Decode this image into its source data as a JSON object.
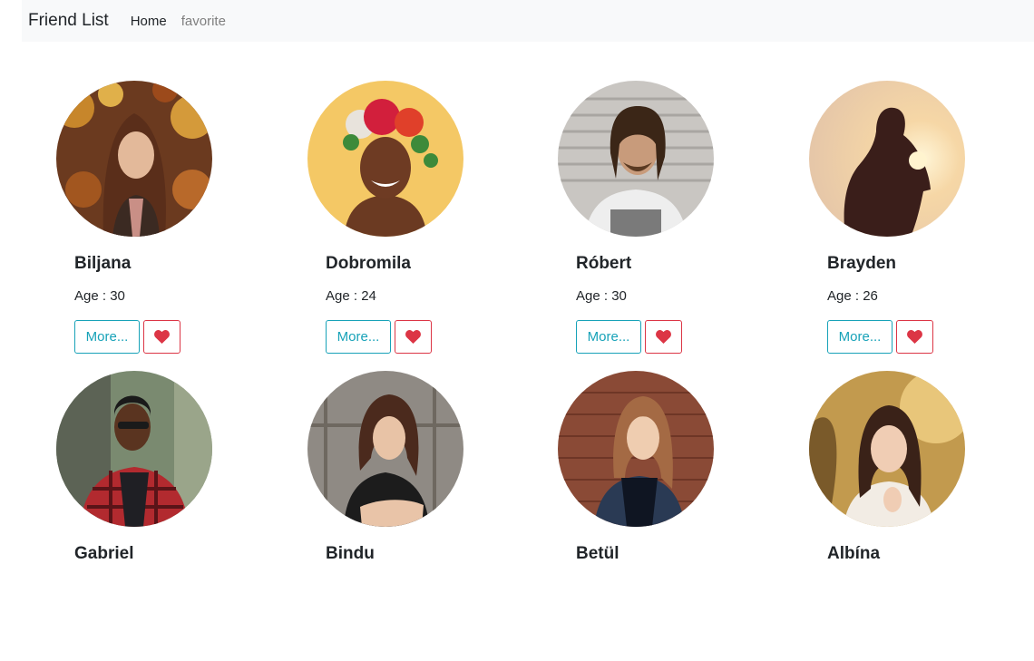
{
  "navbar": {
    "brand": "Friend List",
    "links": [
      {
        "label": "Home"
      },
      {
        "label": "favorite"
      }
    ]
  },
  "more_label": "More...",
  "icons": {
    "favorite": "heart-icon"
  },
  "colors": {
    "info": "#17a2b8",
    "danger": "#dc3545",
    "navbar_bg": "#f8f9fa"
  },
  "friends": [
    {
      "name": "Biljana",
      "age": "Age : 30"
    },
    {
      "name": "Dobromila",
      "age": "Age : 24"
    },
    {
      "name": "Róbert",
      "age": "Age : 30"
    },
    {
      "name": "Brayden",
      "age": "Age : 26"
    },
    {
      "name": "Gabriel",
      "age": ""
    },
    {
      "name": "Bindu",
      "age": ""
    },
    {
      "name": "Betül",
      "age": ""
    },
    {
      "name": "Albína",
      "age": ""
    }
  ]
}
